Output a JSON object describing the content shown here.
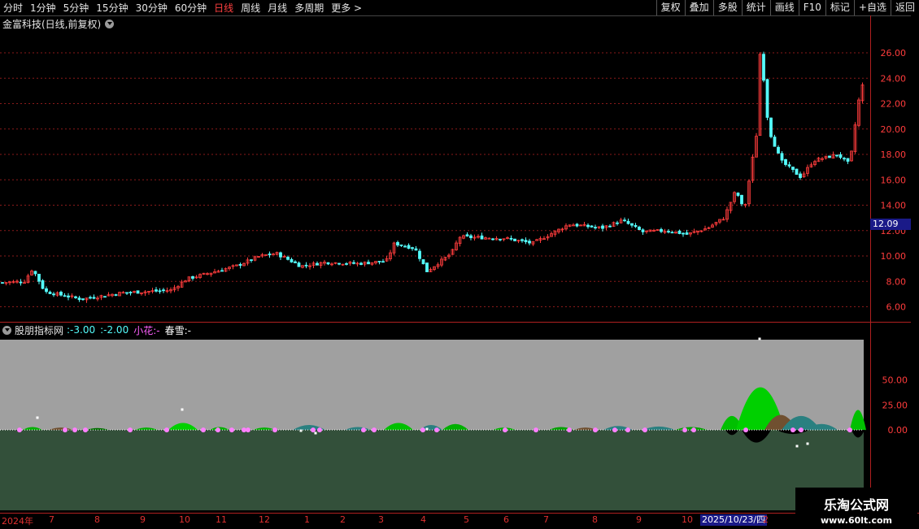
{
  "toolbar": {
    "periods": [
      "分时",
      "1分钟",
      "5分钟",
      "15分钟",
      "30分钟",
      "60分钟",
      "日线",
      "周线",
      "月线",
      "多周期",
      "更多 >"
    ],
    "active_period": "日线",
    "buttons": [
      "复权",
      "叠加",
      "多股",
      "统计",
      "画线",
      "F10",
      "标记",
      "+自选",
      "返回"
    ]
  },
  "main_chart": {
    "title": "金富科技(日线,前复权)",
    "current_price_label": "12.09"
  },
  "indicator": {
    "name": "股朋指标网",
    "value1": ":-3.00",
    "value2": ":-2.00",
    "label_xiaohua": "小花:-",
    "label_chunxue": "春雪:-"
  },
  "dates": {
    "ticks": [
      "2024年",
      "7",
      "8",
      "9",
      "10",
      "11",
      "12",
      "1",
      "2",
      "3",
      "4",
      "5",
      "6",
      "7",
      "8",
      "9",
      "10",
      "2"
    ],
    "selected": "2025/10/23/四"
  },
  "watermark": {
    "line1": "乐淘公式网",
    "line2": "www.60lt.com"
  },
  "colors": {
    "up": "#ff3c3c",
    "down": "#54fcfc",
    "axis": "#ff3c3c",
    "grid": "#8a1a1a",
    "gray_band": "#a0a0a0",
    "green_band": "#33503a",
    "bright_green": "#00e000",
    "teal": "#2a8080",
    "brown": "#705030",
    "pink": "#ff80ff"
  },
  "chart_data": {
    "type": "candlestick",
    "title": "金富科技(日线,前复权)",
    "y_ticks": [
      6.0,
      8.0,
      10.0,
      12.0,
      14.0,
      16.0,
      18.0,
      20.0,
      22.0,
      24.0,
      26.0
    ],
    "ylim": [
      5.2,
      27.6
    ],
    "keypoints": [
      [
        0,
        7.9
      ],
      [
        30,
        8.0
      ],
      [
        40,
        9.0
      ],
      [
        55,
        7.2
      ],
      [
        100,
        6.6
      ],
      [
        150,
        7.1
      ],
      [
        210,
        7.3
      ],
      [
        230,
        8.2
      ],
      [
        290,
        9.2
      ],
      [
        320,
        10.0
      ],
      [
        340,
        10.2
      ],
      [
        370,
        9.2
      ],
      [
        400,
        9.5
      ],
      [
        440,
        9.4
      ],
      [
        475,
        9.6
      ],
      [
        485,
        11.0
      ],
      [
        510,
        10.6
      ],
      [
        525,
        8.8
      ],
      [
        555,
        10.2
      ],
      [
        565,
        11.5
      ],
      [
        620,
        11.4
      ],
      [
        655,
        11.0
      ],
      [
        700,
        12.5
      ],
      [
        740,
        12.2
      ],
      [
        765,
        12.8
      ],
      [
        790,
        11.9
      ],
      [
        820,
        12.0
      ],
      [
        845,
        11.7
      ],
      [
        870,
        12.2
      ],
      [
        890,
        13.0
      ],
      [
        905,
        15.2
      ],
      [
        915,
        13.5
      ],
      [
        930,
        19.5
      ],
      [
        935,
        26.6
      ],
      [
        945,
        20.0
      ],
      [
        960,
        17.5
      ],
      [
        985,
        16.2
      ],
      [
        1000,
        17.5
      ],
      [
        1030,
        18.0
      ],
      [
        1045,
        17.2
      ],
      [
        1055,
        22.0
      ],
      [
        1062,
        23.8
      ]
    ],
    "indicator_y_ticks": [
      50.0,
      25.0,
      0.0
    ],
    "indicator_ylim": [
      -80,
      90
    ]
  }
}
